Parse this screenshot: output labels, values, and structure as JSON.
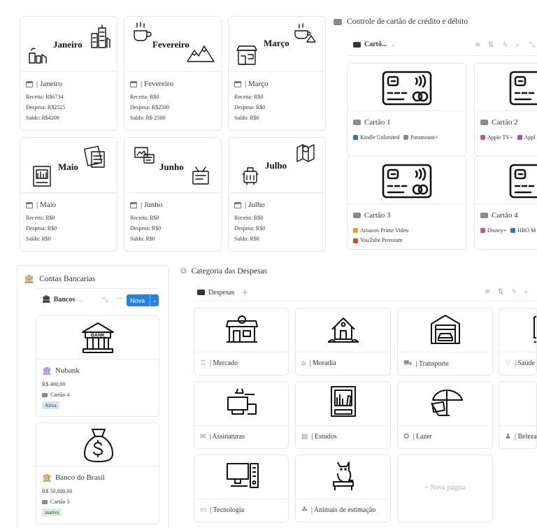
{
  "months": [
    {
      "name": "Janeiro",
      "title": "| Janeiro",
      "receita": "Receita: R$6734",
      "despesa": "Despesa: R$2525",
      "saldo": "Saldo: R$4209"
    },
    {
      "name": "Fevereiro",
      "title": "| Fevereiro",
      "receita": "Receita: R$0",
      "despesa": "Despesa: R$2500",
      "saldo": "Saldo: R$-2500"
    },
    {
      "name": "Março",
      "title": "| Março",
      "receita": "Receita: R$0",
      "despesa": "Despesa: R$0",
      "saldo": "Saldo: R$0"
    },
    {
      "name": "Maio",
      "title": "| Maio",
      "receita": "Receita: R$0",
      "despesa": "Despesa: R$0",
      "saldo": "Saldo: R$0"
    },
    {
      "name": "Junho",
      "title": "| Junho",
      "receita": "Receita: R$0",
      "despesa": "Despesa: R$0",
      "saldo": "Saldo: R$0"
    },
    {
      "name": "Julho",
      "title": "| Julho",
      "receita": "Receita: R$0",
      "despesa": "Despesa: R$0",
      "saldo": "Saldo: R$0"
    }
  ],
  "cards_section": {
    "title": "Controle de cartão de crédito e débito",
    "view_label": "Cartõ...",
    "cards": [
      {
        "name": "Cartão 1",
        "tags": [
          {
            "label": "Kindle Unlimited",
            "color": "#2f6fd6"
          },
          {
            "label": "Paramount+",
            "color": "#8a8a87"
          }
        ]
      },
      {
        "name": "Cartão 2",
        "tags": [
          {
            "label": "Apple TV+",
            "color": "#d44c8a"
          },
          {
            "label": "Appl",
            "color": "#9b59b6"
          }
        ]
      },
      {
        "name": "Cartão 3",
        "tags": [
          {
            "label": "Amazon Prime Video",
            "color": "#e0a030"
          },
          {
            "label": "YouTube Premium",
            "color": "#d9453a"
          }
        ]
      },
      {
        "name": "Cartão 4",
        "tags": [
          {
            "label": "Disney+",
            "color": "#d44c8a"
          },
          {
            "label": "HBO M",
            "color": "#2f6fd6"
          }
        ]
      }
    ]
  },
  "banks_section": {
    "title": "Contas Bancarias",
    "view_label": "Bancos",
    "new_label": "Nova",
    "banks": [
      {
        "name": "Nubank",
        "balance": "R$ 400,00",
        "card": "Cartão 4",
        "status": "Ativa",
        "status_bg": "#d3e5ef",
        "status_fg": "#183347"
      },
      {
        "name": "Banco do Brasil",
        "balance": "R$ 50.000,00",
        "card": "Cartão 3",
        "status": "inativa",
        "status_bg": "#dbeddb",
        "status_fg": "#1c3829"
      }
    ]
  },
  "expenses_section": {
    "title": "Categoria das Despesas",
    "view_label": "Despesas",
    "add_label": "+",
    "categories": [
      {
        "label": "| Mercado",
        "icon": "♖"
      },
      {
        "label": "| Moradia",
        "icon": "⌂"
      },
      {
        "label": "| Transporte",
        "icon": "⛟"
      },
      {
        "label": "| Saúde",
        "icon": "♡"
      },
      {
        "label": "| Assinaturas",
        "icon": "✉"
      },
      {
        "label": "| Estudos",
        "icon": "▤"
      },
      {
        "label": "| Lazer",
        "icon": "✪"
      },
      {
        "label": "| Beleza",
        "icon": "♟"
      },
      {
        "label": "| Tecnologia",
        "icon": "▭"
      },
      {
        "label": "| Animais de estimação",
        "icon": "☘"
      }
    ],
    "new_page_label": "+ Nova página"
  },
  "colors": {
    "accent": "#2383e2",
    "bank_icon": "#a06a1e",
    "bank_icon_purple": "#7b4fa0"
  }
}
